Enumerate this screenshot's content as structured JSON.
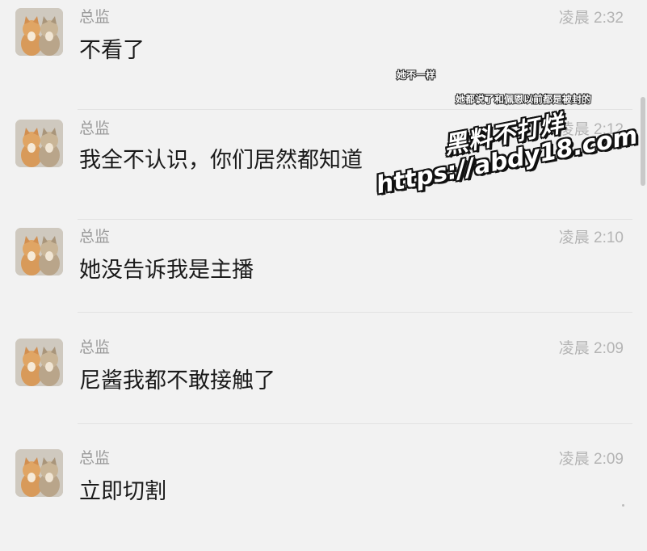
{
  "messages": [
    {
      "sender": "总监",
      "time": "凌晨 2:32",
      "text": "不看了"
    },
    {
      "sender": "总监",
      "time": "凌晨 2:12",
      "text": "我全不认识，你们居然都知道"
    },
    {
      "sender": "总监",
      "time": "凌晨 2:10",
      "text": "她没告诉我是主播"
    },
    {
      "sender": "总监",
      "time": "凌晨 2:09",
      "text": "尼酱我都不敢接触了"
    },
    {
      "sender": "总监",
      "time": "凌晨 2:09",
      "text": "立即切割"
    }
  ],
  "captions": [
    "她不一样",
    "她都说了和佩恩以前都是被封的"
  ],
  "watermark": {
    "line1": "黑料不打烊",
    "line2": "https://abdy18.com"
  },
  "avatar_icon": "cats-avatar-icon",
  "colors": {
    "background": "#f2f2f2",
    "sender": "#9a9a9a",
    "time": "#b4b4b4",
    "text": "#1a1a1a"
  }
}
